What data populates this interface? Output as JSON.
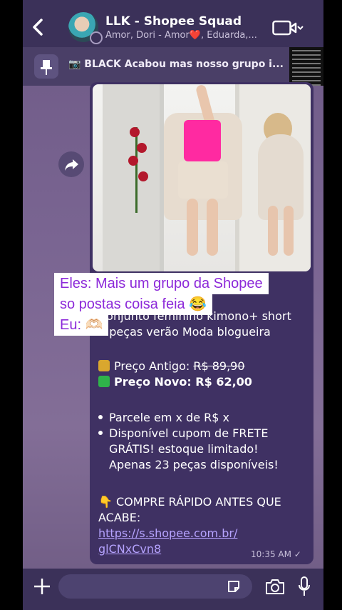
{
  "header": {
    "title": "LLK - Shopee Squad",
    "subtitle": "Amor, Dori - Amor❤️, Eduarda,..."
  },
  "pinned": {
    "text": "📷 BLACK Acabou mas nosso grupo i..."
  },
  "message": {
    "description_lines": [
      "Conjunto feminino kimono+ short",
      "2 peças verão  Moda blogueira"
    ],
    "old_price_label": "Preço Antigo: ",
    "old_price": "R$ 89,90",
    "new_price_label": "Preço Novo: R$ 62,00",
    "bullets": [
      "Parcele em x de R$ x",
      "Disponível cupom de FRETE",
      "GRÁTIS! estoque limitado!",
      "Apenas  23  peças disponíveis!"
    ],
    "cta_line1": "👇 COMPRE RÁPIDO ANTES QUE",
    "cta_line2": "ACABE:",
    "link_line1": "https://s.shopee.com.br/",
    "link_line2": "glCNxCvn8",
    "time": "10:35 AM ✓"
  },
  "overlay_caption": {
    "line1": "Eles: Mais um grupo da Shopee",
    "line2": "so postas coisa feia 😂",
    "line3": "Eu: 🫶🏻"
  },
  "icons": [
    "back-arrow-icon",
    "video-call-icon",
    "pin-icon",
    "forward-icon",
    "plus-icon",
    "sticker-icon",
    "camera-icon",
    "mic-icon"
  ],
  "colors": {
    "header": "#3b3159",
    "bubble": "#3f3163",
    "link": "#b6a3ff",
    "caption_text": "#8c29d9",
    "accent_pink": "#ff2aa1"
  }
}
